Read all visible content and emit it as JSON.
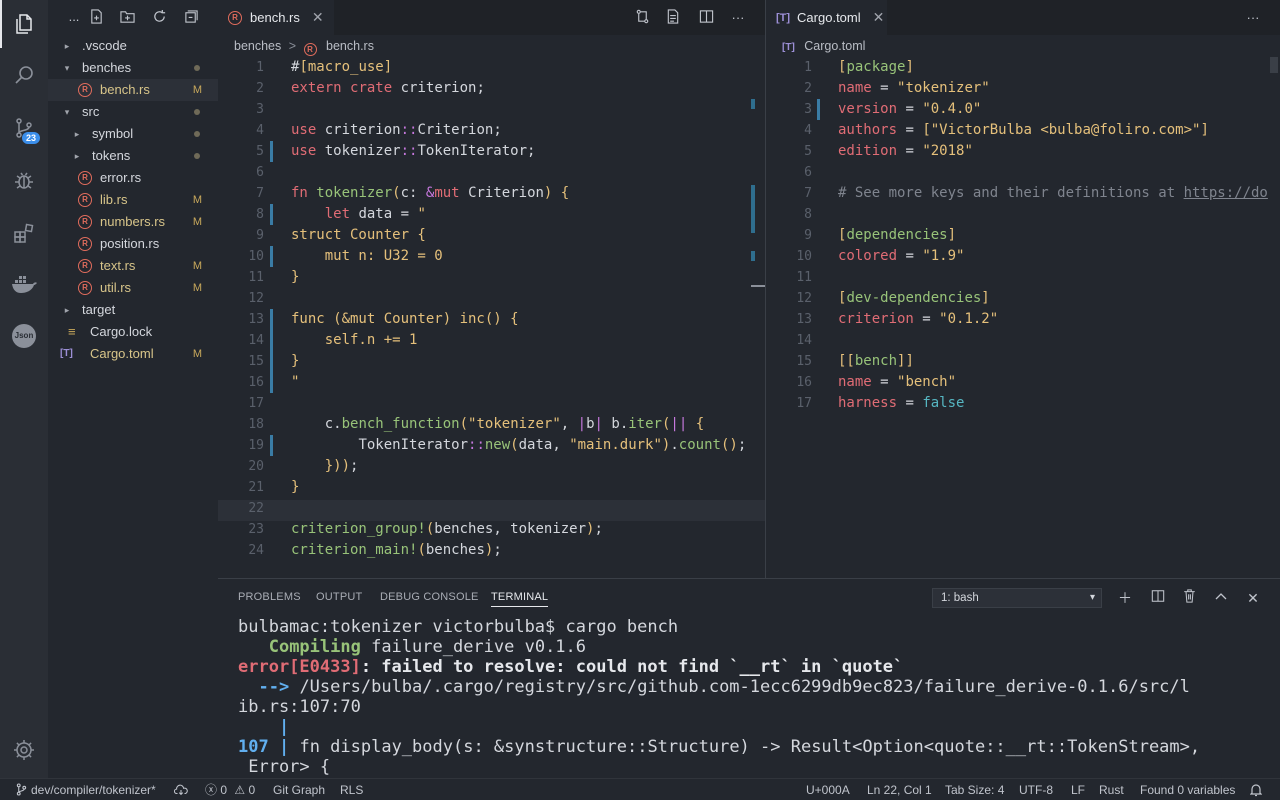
{
  "sidebar": {
    "more": "...",
    "items": [
      {
        "label": ".vscode",
        "type": "folder",
        "collapsed": true,
        "depth": 0
      },
      {
        "label": "benches",
        "type": "folder",
        "collapsed": false,
        "depth": 0,
        "dot": true
      },
      {
        "label": "bench.rs",
        "type": "rust",
        "depth": 1,
        "status": "M",
        "active": true
      },
      {
        "label": "src",
        "type": "folder",
        "collapsed": false,
        "depth": 0,
        "dot": true
      },
      {
        "label": "symbol",
        "type": "folder",
        "collapsed": true,
        "depth": 1,
        "dot": true
      },
      {
        "label": "tokens",
        "type": "folder",
        "collapsed": true,
        "depth": 1,
        "dot": true
      },
      {
        "label": "error.rs",
        "type": "rust",
        "depth": 1
      },
      {
        "label": "lib.rs",
        "type": "rust",
        "depth": 1,
        "status": "M"
      },
      {
        "label": "numbers.rs",
        "type": "rust",
        "depth": 1,
        "status": "M"
      },
      {
        "label": "position.rs",
        "type": "rust",
        "depth": 1
      },
      {
        "label": "text.rs",
        "type": "rust",
        "depth": 1,
        "status": "M"
      },
      {
        "label": "util.rs",
        "type": "rust",
        "depth": 1,
        "status": "M"
      },
      {
        "label": "target",
        "type": "folder",
        "collapsed": true,
        "depth": 0
      },
      {
        "label": "Cargo.lock",
        "type": "lock",
        "depth": 0
      },
      {
        "label": "Cargo.toml",
        "type": "toml",
        "depth": 0,
        "status": "M"
      }
    ]
  },
  "activity": {
    "scm_badge": "23",
    "json_label": "Json"
  },
  "left_editor": {
    "tab_label": "bench.rs",
    "breadcrumb_folder": "benches",
    "breadcrumb_sep": ">",
    "breadcrumb_file": "bench.rs",
    "lines": [
      "#[macro_use]",
      "extern crate criterion;",
      "",
      "use criterion::Criterion;",
      "use tokenizer::TokenIterator;",
      "",
      "fn tokenizer(c: &mut Criterion) {",
      "    let data = \"",
      "struct Counter {",
      "    mut n: U32 = 0",
      "}",
      "",
      "func (&mut Counter) inc() {",
      "    self.n += 1",
      "}",
      "\"",
      "",
      "    c.bench_function(\"tokenizer\", |b| b.iter(|| {",
      "        TokenIterator::new(data, \"main.durk\").count();",
      "    }));",
      "}",
      "",
      "criterion_group!(benches, tokenizer);",
      "criterion_main!(benches);"
    ]
  },
  "right_editor": {
    "tab_label": "Cargo.toml",
    "breadcrumb_file": "Cargo.toml",
    "lines": [
      "[package]",
      "name = \"tokenizer\"",
      "version = \"0.4.0\"",
      "authors = [\"VictorBulba <bulba@foliro.com>\"]",
      "edition = \"2018\"",
      "",
      "# See more keys and their definitions at https://do",
      "",
      "[dependencies]",
      "colored = \"1.9\"",
      "",
      "[dev-dependencies]",
      "criterion = \"0.1.2\"",
      "",
      "[[bench]]",
      "name = \"bench\"",
      "harness = false"
    ]
  },
  "panel": {
    "tabs": [
      "PROBLEMS",
      "OUTPUT",
      "DEBUG CONSOLE",
      "TERMINAL"
    ],
    "terminal_select": "1: bash",
    "terminal": {
      "prompt": "bulbamac:tokenizer victorbulba$ cargo bench",
      "compiling_word": "Compiling",
      "compiling_rest": " failure_derive v0.1.6",
      "error_code": "error[E0433]",
      "error_msg": ": failed to resolve: could not find `__rt` in `quote`",
      "arrow": "-->",
      "path1": " /Users/bulba/.cargo/registry/src/github.com-1ecc6299db9ec823/failure_derive-0.1.6/src/l",
      "path2": "ib.rs:107:70",
      "pipe": "|",
      "line_no": "107",
      "src1": " fn display_body(s: &synstructure::Structure) -> Result<Option<quote::__rt::TokenStream>,",
      "src2": " Error> {"
    }
  },
  "status": {
    "branch": "dev/compiler/tokenizer*",
    "errors": "0",
    "warnings": "0",
    "git_graph": "Git Graph",
    "rls": "RLS",
    "char": "U+000A",
    "position": "Ln 22, Col 1",
    "tab_size": "Tab Size: 4",
    "encoding": "UTF-8",
    "eol": "LF",
    "language": "Rust",
    "variables": "Found 0 variables"
  },
  "colors": {
    "background": "#23272e",
    "accent_blue": "#3b8eea",
    "git_modified": "#c9a95c",
    "keyword": "#e06c75",
    "string": "#e5c07b",
    "function": "#98c379"
  }
}
